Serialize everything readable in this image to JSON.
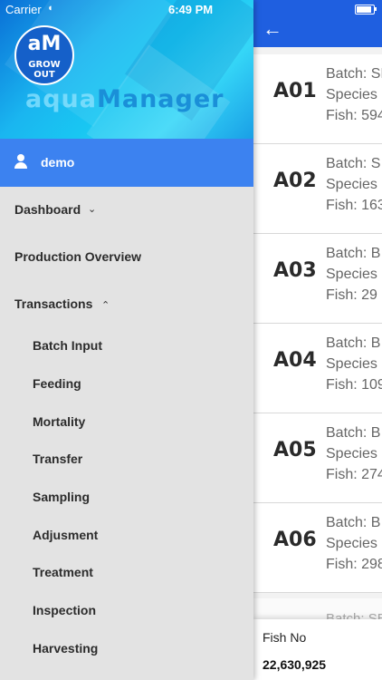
{
  "status_bar": {
    "carrier": "Carrier",
    "time": "6:49 PM"
  },
  "drawer": {
    "logo": {
      "line1": "aM",
      "line2": "GROW OUT"
    },
    "brand": {
      "part1": "aqua",
      "part2": "Manager"
    },
    "user": {
      "name": "demo"
    },
    "menu": {
      "dashboard": "Dashboard",
      "production_overview": "Production Overview",
      "transactions": "Transactions",
      "sub": [
        "Batch Input",
        "Feeding",
        "Mortality",
        "Transfer",
        "Sampling",
        "Adjusment",
        "Treatment",
        "Inspection",
        "Harvesting"
      ]
    }
  },
  "main": {
    "cards": [
      {
        "code": "A01",
        "batch": "Batch: SE",
        "species": "Species S",
        "fish": "Fish: 594"
      },
      {
        "code": "A02",
        "batch": "Batch: S",
        "species": "Species",
        "fish": "Fish: 163"
      },
      {
        "code": "A03",
        "batch": "Batch: B",
        "species": "Species",
        "fish": "Fish: 29"
      },
      {
        "code": "A04",
        "batch": "Batch: B",
        "species": "Species",
        "fish": "Fish: 109"
      },
      {
        "code": "A05",
        "batch": "Batch: B",
        "species": "Species",
        "fish": "Fish: 274"
      },
      {
        "code": "A06",
        "batch": "Batch: B",
        "species": "Species",
        "fish": "Fish: 298"
      }
    ],
    "peek": "Batch: SE",
    "summary": {
      "label": "Fish No",
      "value": "22,630,925"
    }
  }
}
